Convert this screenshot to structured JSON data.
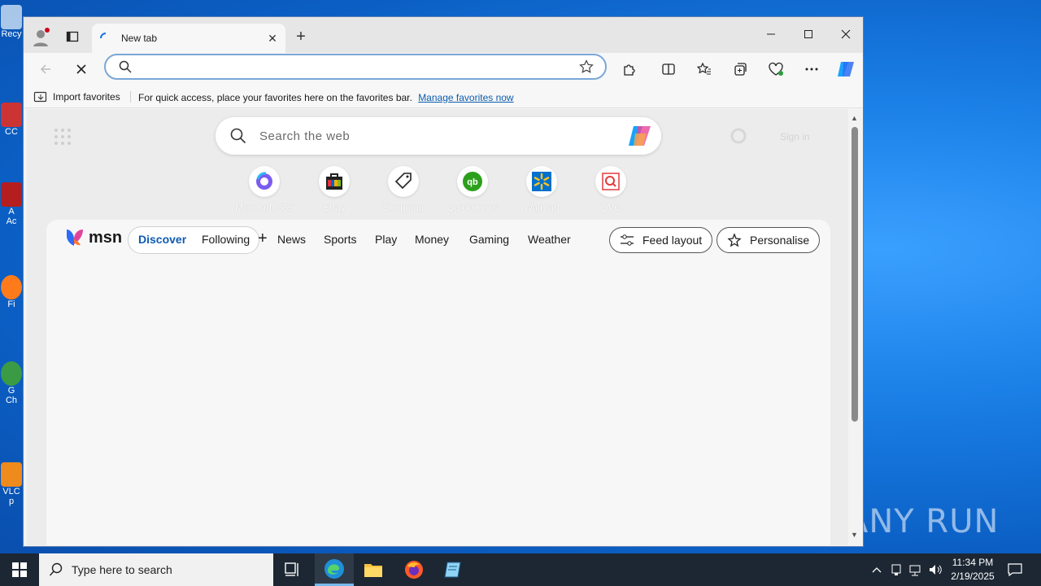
{
  "desktop": {
    "icons": [
      {
        "label": "Recy"
      },
      {
        "label": "CC"
      },
      {
        "label": "A\nAc"
      },
      {
        "label": "Fi"
      },
      {
        "label": "G\nCh"
      },
      {
        "label": "VLC\np"
      }
    ],
    "watermark": "ANY RUN"
  },
  "browser": {
    "tab": {
      "title": "New tab"
    },
    "address": {
      "value": "",
      "placeholder": ""
    },
    "favorites_bar": {
      "import_label": "Import favorites",
      "message": "For quick access, place your favorites here on the favorites bar.",
      "link": "Manage favorites now"
    },
    "newtab": {
      "search_placeholder": "Search the web",
      "signin": "Sign in",
      "quick_links": [
        {
          "label": "Microsoft 365",
          "icon": "microsoft365-icon"
        },
        {
          "label": "Ebay",
          "icon": "ebay-icon"
        },
        {
          "label": "Shopping",
          "icon": "shopping-tag-icon"
        },
        {
          "label": "Quickbooks",
          "icon": "quickbooks-icon"
        },
        {
          "label": "Walmart",
          "icon": "walmart-icon"
        },
        {
          "label": "QVC",
          "icon": "qvc-icon"
        }
      ],
      "feed": {
        "brand": "msn",
        "tabs": [
          "Discover",
          "Following"
        ],
        "nav": [
          "News",
          "Sports",
          "Play",
          "Money",
          "Gaming",
          "Weather"
        ],
        "feed_layout": "Feed layout",
        "personalise": "Personalise"
      }
    }
  },
  "taskbar": {
    "search_placeholder": "Type here to search",
    "time": "11:34 PM",
    "date": "2/19/2025"
  },
  "colors": {
    "accent": "#0f5bb5",
    "taskbar": "#1c2733",
    "desktop": "#1a7fe6"
  }
}
